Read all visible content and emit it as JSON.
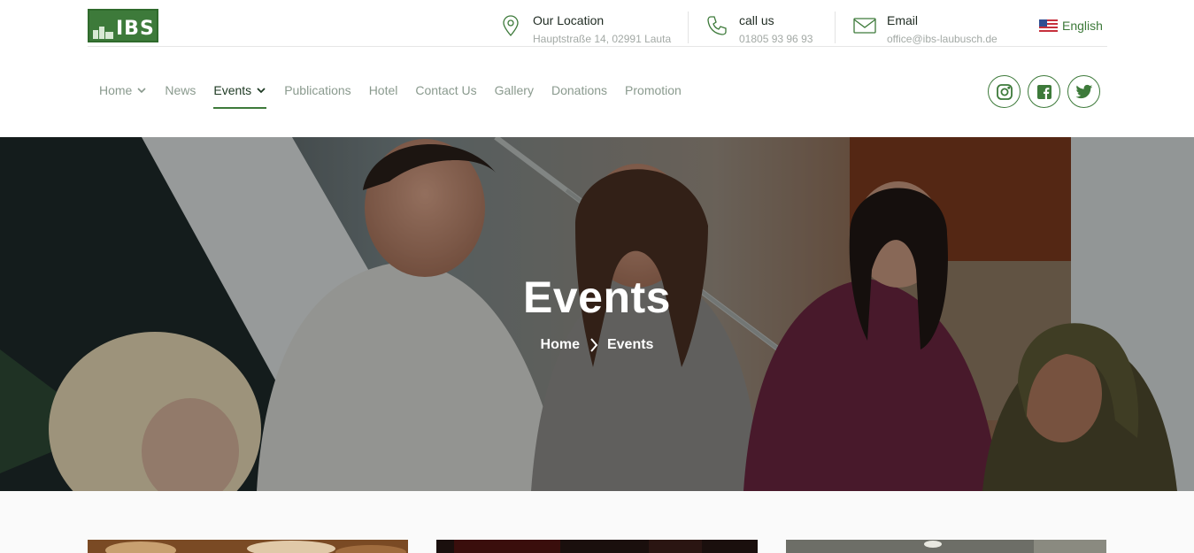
{
  "brand": {
    "logo_text": "IBS"
  },
  "contacts": [
    {
      "title": "Our Location",
      "sub": "Hauptstraße 14, 02991 Lauta",
      "icon": "location-pin-icon"
    },
    {
      "title": "call us",
      "sub": "01805 93 96 93",
      "icon": "phone-icon"
    },
    {
      "title": "Email",
      "sub": "office@ibs-laubusch.de",
      "icon": "envelope-icon"
    }
  ],
  "language": {
    "label": "English",
    "icon": "us-flag-icon"
  },
  "nav": {
    "items": [
      {
        "label": "Home",
        "has_dropdown": true,
        "active": false
      },
      {
        "label": "News",
        "has_dropdown": false,
        "active": false
      },
      {
        "label": "Events",
        "has_dropdown": true,
        "active": true
      },
      {
        "label": "Publications",
        "has_dropdown": false,
        "active": false
      },
      {
        "label": "Hotel",
        "has_dropdown": false,
        "active": false
      },
      {
        "label": "Contact Us",
        "has_dropdown": false,
        "active": false
      },
      {
        "label": "Gallery",
        "has_dropdown": false,
        "active": false
      },
      {
        "label": "Donations",
        "has_dropdown": false,
        "active": false
      },
      {
        "label": "Promotion",
        "has_dropdown": false,
        "active": false
      }
    ]
  },
  "social": [
    "instagram-icon",
    "facebook-icon",
    "twitter-icon"
  ],
  "hero": {
    "title": "Events",
    "breadcrumb": [
      "Home",
      "Events"
    ]
  },
  "colors": {
    "brand_green": "#3d7a3a",
    "nav_text": "#8a9a8e",
    "nav_active": "#1e3a23"
  }
}
